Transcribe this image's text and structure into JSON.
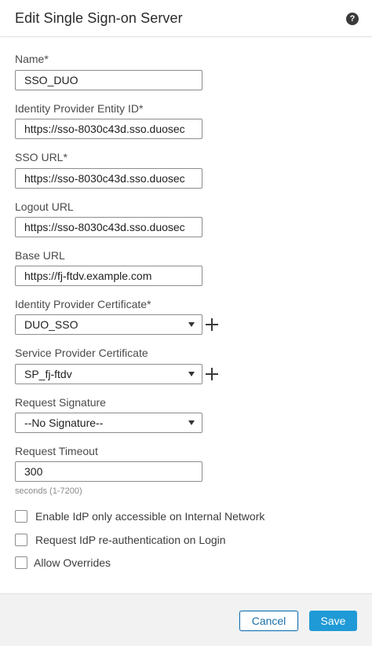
{
  "dialog": {
    "title": "Edit Single Sign-on Server",
    "help_icon": "?"
  },
  "fields": {
    "name": {
      "label": "Name*",
      "value": "SSO_DUO"
    },
    "entity_id": {
      "label": "Identity Provider Entity ID*",
      "value": "https://sso-8030c43d.sso.duosec"
    },
    "sso_url": {
      "label": "SSO URL*",
      "value": "https://sso-8030c43d.sso.duosec"
    },
    "logout_url": {
      "label": "Logout URL",
      "value": "https://sso-8030c43d.sso.duosec"
    },
    "base_url": {
      "label": "Base URL",
      "value": "https://fj-ftdv.example.com"
    },
    "idp_cert": {
      "label": "Identity Provider Certificate*",
      "value": "DUO_SSO"
    },
    "sp_cert": {
      "label": "Service Provider Certificate",
      "value": "SP_fj-ftdv"
    },
    "request_signature": {
      "label": "Request Signature",
      "value": "--No Signature--"
    },
    "request_timeout": {
      "label": "Request Timeout",
      "value": "300",
      "hint": "seconds (1-7200)"
    }
  },
  "checkboxes": {
    "internal_network": {
      "label": "Enable IdP only accessible on Internal Network",
      "checked": false
    },
    "reauth": {
      "label": "Request IdP re-authentication on Login",
      "checked": false
    },
    "overrides": {
      "label": "Allow Overrides",
      "checked": false
    }
  },
  "footer": {
    "cancel_label": "Cancel",
    "save_label": "Save"
  },
  "icons": {
    "help": "help-icon",
    "dropdown": "chevron-down-icon",
    "add": "plus-icon"
  },
  "colors": {
    "primary_button": "#1f9ad6",
    "cancel_border": "#1a6fa8",
    "footer_background": "#f2f2f2"
  }
}
